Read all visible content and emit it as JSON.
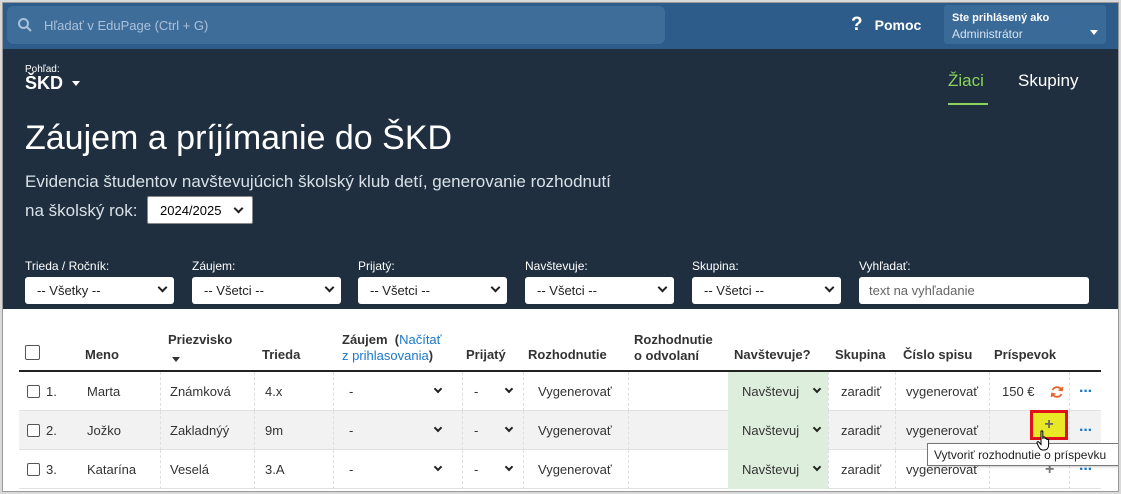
{
  "topbar": {
    "search_placeholder": "Hľadať v EduPage (Ctrl + G)",
    "help_label": "Pomoc",
    "user_line1": "Ste prihlásený ako",
    "user_line2": "Administrátor"
  },
  "header": {
    "view_label": "Pohľad:",
    "view_value": "ŠKD",
    "tabs": [
      "Žiaci",
      "Skupiny"
    ],
    "title": "Záujem a príjímanie do ŠKD",
    "subtitle": "Evidencia študentov navštevujúcich školský klub detí, generovanie rozhodnutí",
    "year_label": "na školský rok:",
    "year_value": "2024/2025"
  },
  "filters": [
    {
      "label": "Trieda / Ročník:",
      "value": "-- Všetky --"
    },
    {
      "label": "Záujem:",
      "value": "-- Všetci --"
    },
    {
      "label": "Prijatý:",
      "value": "-- Všetci --"
    },
    {
      "label": "Navštevuje:",
      "value": "-- Všetci --"
    },
    {
      "label": "Skupina:",
      "value": "-- Všetci --"
    },
    {
      "label": "Vyhľadať:",
      "placeholder": "text na vyhľadanie"
    }
  ],
  "table": {
    "headers": {
      "meno": "Meno",
      "priezvisko": "Priezvisko",
      "trieda": "Trieda",
      "zaujem": "Záujem",
      "zaujem_link1": "Načítať",
      "zaujem_link2": "z prihlasovania",
      "zaujem_close": ")",
      "zaujem_open": "(",
      "prijaty": "Prijatý",
      "rozhodnutie": "Rozhodnutie",
      "odvolanie1": "Rozhodnutie",
      "odvolanie2": "o odvolaní",
      "navstevuje": "Navštevuje?",
      "skupina": "Skupina",
      "cislo_spisu": "Číslo spisu",
      "prispevok": "Príspevok"
    },
    "rows": [
      {
        "num": "1.",
        "meno": "Marta",
        "priezvisko": "Známková",
        "trieda": "4.x",
        "zaujem": "-",
        "prijaty": "-",
        "rozhodnutie": "Vygenerovať",
        "navstevuje": "Navštevuj",
        "skupina": "zaradiť",
        "cislo_spisu": "vygenerovať",
        "prispevok": "150 €",
        "more": "···"
      },
      {
        "num": "2.",
        "meno": "Jožko",
        "priezvisko": "Zakladnýý",
        "trieda": "9m",
        "zaujem": "-",
        "prijaty": "-",
        "rozhodnutie": "Vygenerovať",
        "navstevuje": "Navštevuj",
        "skupina": "zaradiť",
        "cislo_spisu": "vygenerovať",
        "prispevok": "+",
        "more": "···"
      },
      {
        "num": "3.",
        "meno": "Katarína",
        "priezvisko": "Veselá",
        "trieda": "3.A",
        "zaujem": "-",
        "prijaty": "-",
        "rozhodnutie": "Vygenerovať",
        "navstevuje": "Navštevuj",
        "skupina": "zaradiť",
        "cislo_spisu": "vygenerovať",
        "prispevok": "+",
        "more": "···"
      }
    ],
    "tooltip": "Vytvoriť rozhodnutie o príspevku"
  },
  "colors": {
    "topbar": "#2e5c8a",
    "header_bg": "#1f2f3f",
    "accent_green": "#8bd35a",
    "link_blue": "#1a77c9",
    "highlight_red": "#e0101a"
  }
}
